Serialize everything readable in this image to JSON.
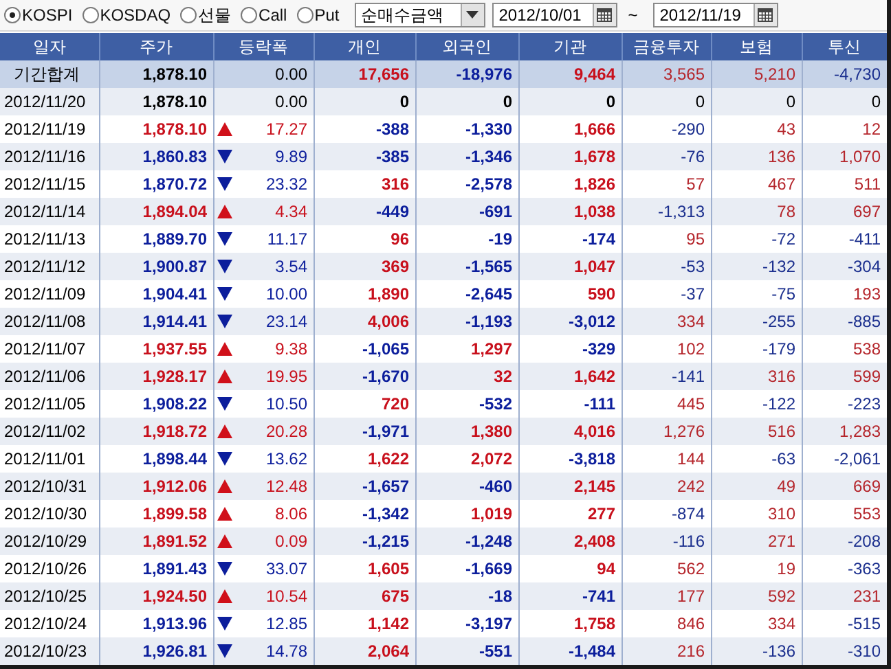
{
  "market_options": [
    {
      "label": "KOSPI",
      "selected": true
    },
    {
      "label": "KOSDAQ",
      "selected": false
    },
    {
      "label": "선물",
      "selected": false
    },
    {
      "label": "Call",
      "selected": false
    },
    {
      "label": "Put",
      "selected": false
    }
  ],
  "value_type": {
    "value": "순매수금액"
  },
  "date_range": {
    "from": "2012/10/01",
    "separator": "~",
    "to": "2012/11/19"
  },
  "table": {
    "columns": [
      "일자",
      "주가",
      "등락폭",
      "개인",
      "외국인",
      "기관",
      "금융투자",
      "보험",
      "투신"
    ],
    "rows": [
      {
        "kind": "total",
        "date": "기간합계",
        "price": "1,878.10",
        "rising": false,
        "falling": false,
        "change": "0.00",
        "investors": [
          {
            "text": "17,656",
            "color": "#c8101c"
          },
          {
            "text": "-18,976",
            "color": "#0c1e9c"
          },
          {
            "text": "9,464",
            "color": "#c8101c"
          },
          {
            "text": "3,565",
            "color": "#b5262c"
          },
          {
            "text": "5,210",
            "color": "#b5262c"
          },
          {
            "text": "-4,730",
            "color": "#1b2f8e"
          }
        ]
      },
      {
        "kind": "day",
        "date": "2012/11/20",
        "price": "1,878.10",
        "rising": false,
        "falling": false,
        "change": "0.00",
        "investors": [
          {
            "text": "0",
            "color": "#000000"
          },
          {
            "text": "0",
            "color": "#000000"
          },
          {
            "text": "0",
            "color": "#000000"
          },
          {
            "text": "0",
            "color": "#000000"
          },
          {
            "text": "0",
            "color": "#000000"
          },
          {
            "text": "0",
            "color": "#000000"
          }
        ]
      },
      {
        "kind": "day",
        "date": "2012/11/19",
        "price": "1,878.10",
        "rising": true,
        "falling": false,
        "change": "17.27",
        "investors": [
          {
            "text": "-388",
            "color": "#0c1e9c"
          },
          {
            "text": "-1,330",
            "color": "#0c1e9c"
          },
          {
            "text": "1,666",
            "color": "#c8101c"
          },
          {
            "text": "-290",
            "color": "#1b2f8e"
          },
          {
            "text": "43",
            "color": "#b5262c"
          },
          {
            "text": "12",
            "color": "#b5262c"
          }
        ]
      },
      {
        "kind": "day",
        "date": "2012/11/16",
        "price": "1,860.83",
        "rising": false,
        "falling": true,
        "change": "9.89",
        "investors": [
          {
            "text": "-385",
            "color": "#0c1e9c"
          },
          {
            "text": "-1,346",
            "color": "#0c1e9c"
          },
          {
            "text": "1,678",
            "color": "#c8101c"
          },
          {
            "text": "-76",
            "color": "#1b2f8e"
          },
          {
            "text": "136",
            "color": "#b5262c"
          },
          {
            "text": "1,070",
            "color": "#b5262c"
          }
        ]
      },
      {
        "kind": "day",
        "date": "2012/11/15",
        "price": "1,870.72",
        "rising": false,
        "falling": true,
        "change": "23.32",
        "investors": [
          {
            "text": "316",
            "color": "#c8101c"
          },
          {
            "text": "-2,578",
            "color": "#0c1e9c"
          },
          {
            "text": "1,826",
            "color": "#c8101c"
          },
          {
            "text": "57",
            "color": "#b5262c"
          },
          {
            "text": "467",
            "color": "#b5262c"
          },
          {
            "text": "511",
            "color": "#b5262c"
          }
        ]
      },
      {
        "kind": "day",
        "date": "2012/11/14",
        "price": "1,894.04",
        "rising": true,
        "falling": false,
        "change": "4.34",
        "investors": [
          {
            "text": "-449",
            "color": "#0c1e9c"
          },
          {
            "text": "-691",
            "color": "#0c1e9c"
          },
          {
            "text": "1,038",
            "color": "#c8101c"
          },
          {
            "text": "-1,313",
            "color": "#1b2f8e"
          },
          {
            "text": "78",
            "color": "#b5262c"
          },
          {
            "text": "697",
            "color": "#b5262c"
          }
        ]
      },
      {
        "kind": "day",
        "date": "2012/11/13",
        "price": "1,889.70",
        "rising": false,
        "falling": true,
        "change": "11.17",
        "investors": [
          {
            "text": "96",
            "color": "#c8101c"
          },
          {
            "text": "-19",
            "color": "#0c1e9c"
          },
          {
            "text": "-174",
            "color": "#0c1e9c"
          },
          {
            "text": "95",
            "color": "#b5262c"
          },
          {
            "text": "-72",
            "color": "#1b2f8e"
          },
          {
            "text": "-411",
            "color": "#1b2f8e"
          }
        ]
      },
      {
        "kind": "day",
        "date": "2012/11/12",
        "price": "1,900.87",
        "rising": false,
        "falling": true,
        "change": "3.54",
        "investors": [
          {
            "text": "369",
            "color": "#c8101c"
          },
          {
            "text": "-1,565",
            "color": "#0c1e9c"
          },
          {
            "text": "1,047",
            "color": "#c8101c"
          },
          {
            "text": "-53",
            "color": "#1b2f8e"
          },
          {
            "text": "-132",
            "color": "#1b2f8e"
          },
          {
            "text": "-304",
            "color": "#1b2f8e"
          }
        ]
      },
      {
        "kind": "day",
        "date": "2012/11/09",
        "price": "1,904.41",
        "rising": false,
        "falling": true,
        "change": "10.00",
        "investors": [
          {
            "text": "1,890",
            "color": "#c8101c"
          },
          {
            "text": "-2,645",
            "color": "#0c1e9c"
          },
          {
            "text": "590",
            "color": "#c8101c"
          },
          {
            "text": "-37",
            "color": "#1b2f8e"
          },
          {
            "text": "-75",
            "color": "#1b2f8e"
          },
          {
            "text": "193",
            "color": "#b5262c"
          }
        ]
      },
      {
        "kind": "day",
        "date": "2012/11/08",
        "price": "1,914.41",
        "rising": false,
        "falling": true,
        "change": "23.14",
        "investors": [
          {
            "text": "4,006",
            "color": "#c8101c"
          },
          {
            "text": "-1,193",
            "color": "#0c1e9c"
          },
          {
            "text": "-3,012",
            "color": "#0c1e9c"
          },
          {
            "text": "334",
            "color": "#b5262c"
          },
          {
            "text": "-255",
            "color": "#1b2f8e"
          },
          {
            "text": "-885",
            "color": "#1b2f8e"
          }
        ]
      },
      {
        "kind": "day",
        "date": "2012/11/07",
        "price": "1,937.55",
        "rising": true,
        "falling": false,
        "change": "9.38",
        "investors": [
          {
            "text": "-1,065",
            "color": "#0c1e9c"
          },
          {
            "text": "1,297",
            "color": "#c8101c"
          },
          {
            "text": "-329",
            "color": "#0c1e9c"
          },
          {
            "text": "102",
            "color": "#b5262c"
          },
          {
            "text": "-179",
            "color": "#1b2f8e"
          },
          {
            "text": "538",
            "color": "#b5262c"
          }
        ]
      },
      {
        "kind": "day",
        "date": "2012/11/06",
        "price": "1,928.17",
        "rising": true,
        "falling": false,
        "change": "19.95",
        "investors": [
          {
            "text": "-1,670",
            "color": "#0c1e9c"
          },
          {
            "text": "32",
            "color": "#c8101c"
          },
          {
            "text": "1,642",
            "color": "#c8101c"
          },
          {
            "text": "-141",
            "color": "#1b2f8e"
          },
          {
            "text": "316",
            "color": "#b5262c"
          },
          {
            "text": "599",
            "color": "#b5262c"
          }
        ]
      },
      {
        "kind": "day",
        "date": "2012/11/05",
        "price": "1,908.22",
        "rising": false,
        "falling": true,
        "change": "10.50",
        "investors": [
          {
            "text": "720",
            "color": "#c8101c"
          },
          {
            "text": "-532",
            "color": "#0c1e9c"
          },
          {
            "text": "-111",
            "color": "#0c1e9c"
          },
          {
            "text": "445",
            "color": "#b5262c"
          },
          {
            "text": "-122",
            "color": "#1b2f8e"
          },
          {
            "text": "-223",
            "color": "#1b2f8e"
          }
        ]
      },
      {
        "kind": "day",
        "date": "2012/11/02",
        "price": "1,918.72",
        "rising": true,
        "falling": false,
        "change": "20.28",
        "investors": [
          {
            "text": "-1,971",
            "color": "#0c1e9c"
          },
          {
            "text": "1,380",
            "color": "#c8101c"
          },
          {
            "text": "4,016",
            "color": "#c8101c"
          },
          {
            "text": "1,276",
            "color": "#b5262c"
          },
          {
            "text": "516",
            "color": "#b5262c"
          },
          {
            "text": "1,283",
            "color": "#b5262c"
          }
        ]
      },
      {
        "kind": "day",
        "date": "2012/11/01",
        "price": "1,898.44",
        "rising": false,
        "falling": true,
        "change": "13.62",
        "investors": [
          {
            "text": "1,622",
            "color": "#c8101c"
          },
          {
            "text": "2,072",
            "color": "#c8101c"
          },
          {
            "text": "-3,818",
            "color": "#0c1e9c"
          },
          {
            "text": "144",
            "color": "#b5262c"
          },
          {
            "text": "-63",
            "color": "#1b2f8e"
          },
          {
            "text": "-2,061",
            "color": "#1b2f8e"
          }
        ]
      },
      {
        "kind": "day",
        "date": "2012/10/31",
        "price": "1,912.06",
        "rising": true,
        "falling": false,
        "change": "12.48",
        "investors": [
          {
            "text": "-1,657",
            "color": "#0c1e9c"
          },
          {
            "text": "-460",
            "color": "#0c1e9c"
          },
          {
            "text": "2,145",
            "color": "#c8101c"
          },
          {
            "text": "242",
            "color": "#b5262c"
          },
          {
            "text": "49",
            "color": "#b5262c"
          },
          {
            "text": "669",
            "color": "#b5262c"
          }
        ]
      },
      {
        "kind": "day",
        "date": "2012/10/30",
        "price": "1,899.58",
        "rising": true,
        "falling": false,
        "change": "8.06",
        "investors": [
          {
            "text": "-1,342",
            "color": "#0c1e9c"
          },
          {
            "text": "1,019",
            "color": "#c8101c"
          },
          {
            "text": "277",
            "color": "#c8101c"
          },
          {
            "text": "-874",
            "color": "#1b2f8e"
          },
          {
            "text": "310",
            "color": "#b5262c"
          },
          {
            "text": "553",
            "color": "#b5262c"
          }
        ]
      },
      {
        "kind": "day",
        "date": "2012/10/29",
        "price": "1,891.52",
        "rising": true,
        "falling": false,
        "change": "0.09",
        "investors": [
          {
            "text": "-1,215",
            "color": "#0c1e9c"
          },
          {
            "text": "-1,248",
            "color": "#0c1e9c"
          },
          {
            "text": "2,408",
            "color": "#c8101c"
          },
          {
            "text": "-116",
            "color": "#1b2f8e"
          },
          {
            "text": "271",
            "color": "#b5262c"
          },
          {
            "text": "-208",
            "color": "#1b2f8e"
          }
        ]
      },
      {
        "kind": "day",
        "date": "2012/10/26",
        "price": "1,891.43",
        "rising": false,
        "falling": true,
        "change": "33.07",
        "investors": [
          {
            "text": "1,605",
            "color": "#c8101c"
          },
          {
            "text": "-1,669",
            "color": "#0c1e9c"
          },
          {
            "text": "94",
            "color": "#c8101c"
          },
          {
            "text": "562",
            "color": "#b5262c"
          },
          {
            "text": "19",
            "color": "#b5262c"
          },
          {
            "text": "-363",
            "color": "#1b2f8e"
          }
        ]
      },
      {
        "kind": "day",
        "date": "2012/10/25",
        "price": "1,924.50",
        "rising": true,
        "falling": false,
        "change": "10.54",
        "investors": [
          {
            "text": "675",
            "color": "#c8101c"
          },
          {
            "text": "-18",
            "color": "#0c1e9c"
          },
          {
            "text": "-741",
            "color": "#0c1e9c"
          },
          {
            "text": "177",
            "color": "#b5262c"
          },
          {
            "text": "592",
            "color": "#b5262c"
          },
          {
            "text": "231",
            "color": "#b5262c"
          }
        ]
      },
      {
        "kind": "day",
        "date": "2012/10/24",
        "price": "1,913.96",
        "rising": false,
        "falling": true,
        "change": "12.85",
        "investors": [
          {
            "text": "1,142",
            "color": "#c8101c"
          },
          {
            "text": "-3,197",
            "color": "#0c1e9c"
          },
          {
            "text": "1,758",
            "color": "#c8101c"
          },
          {
            "text": "846",
            "color": "#b5262c"
          },
          {
            "text": "334",
            "color": "#b5262c"
          },
          {
            "text": "-515",
            "color": "#1b2f8e"
          }
        ]
      },
      {
        "kind": "day",
        "date": "2012/10/23",
        "price": "1,926.81",
        "rising": false,
        "falling": true,
        "change": "14.78",
        "investors": [
          {
            "text": "2,064",
            "color": "#c8101c"
          },
          {
            "text": "-551",
            "color": "#0c1e9c"
          },
          {
            "text": "-1,484",
            "color": "#0c1e9c"
          },
          {
            "text": "216",
            "color": "#b5262c"
          },
          {
            "text": "-136",
            "color": "#1b2f8e"
          },
          {
            "text": "-310",
            "color": "#1b2f8e"
          }
        ]
      }
    ]
  }
}
